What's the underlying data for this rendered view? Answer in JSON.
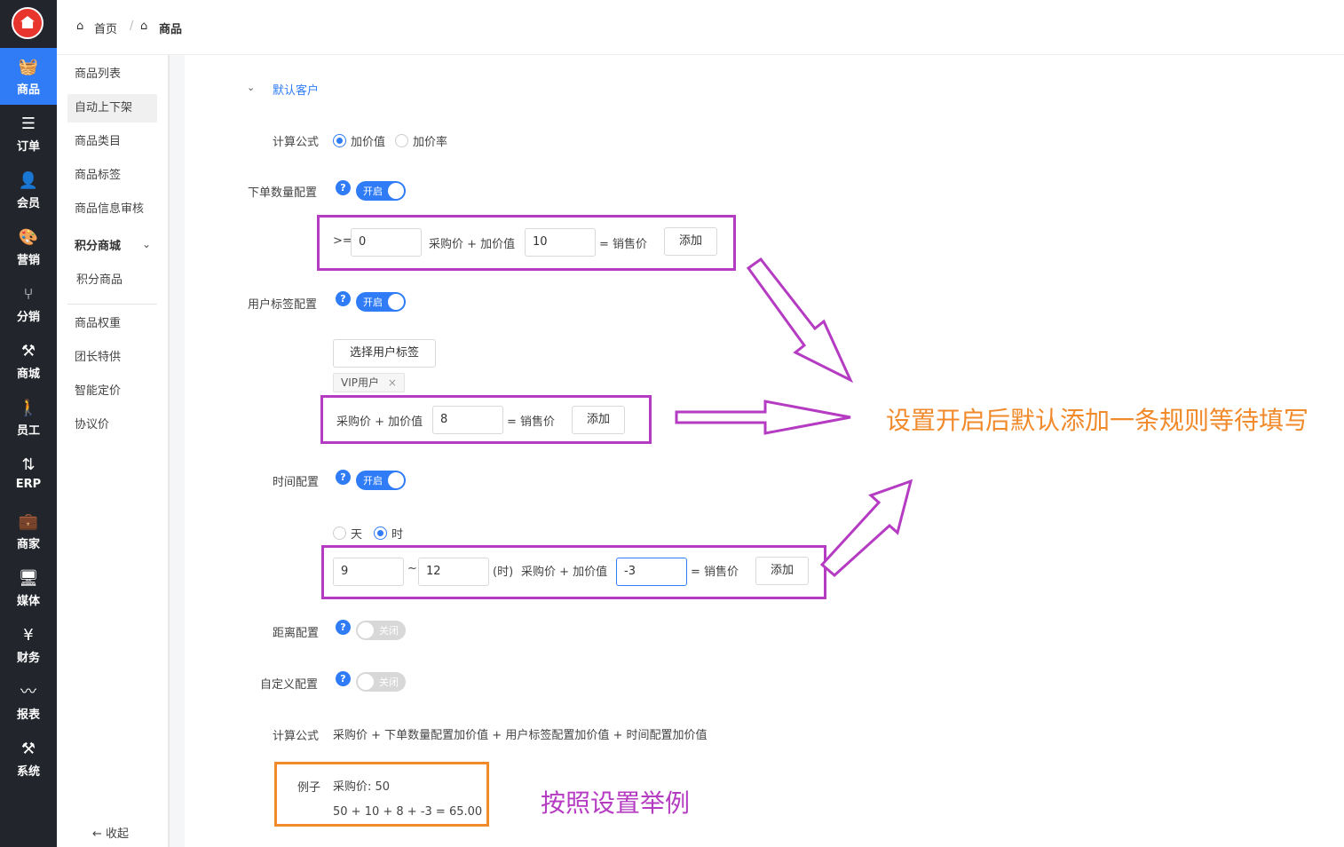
{
  "rail": {
    "items": [
      {
        "label": "商品",
        "icon": "basket-icon",
        "glyph": "🧺"
      },
      {
        "label": "订单",
        "icon": "list-icon",
        "glyph": "☰"
      },
      {
        "label": "会员",
        "icon": "user-plus-icon",
        "glyph": "👤"
      },
      {
        "label": "营销",
        "icon": "palette-icon",
        "glyph": "🎨"
      },
      {
        "label": "分销",
        "icon": "branch-icon",
        "glyph": "⑂"
      },
      {
        "label": "商城",
        "icon": "tools-icon",
        "glyph": "⚒"
      },
      {
        "label": "员工",
        "icon": "person-icon",
        "glyph": "🚶"
      },
      {
        "label": "ERP",
        "icon": "sync-icon",
        "glyph": "⇅"
      },
      {
        "label": "商家",
        "icon": "briefcase-icon",
        "glyph": "💼"
      },
      {
        "label": "媒体",
        "icon": "monitor-icon",
        "glyph": "🖥"
      },
      {
        "label": "财务",
        "icon": "yen-icon",
        "glyph": "¥"
      },
      {
        "label": "报表",
        "icon": "pulse-icon",
        "glyph": "〰"
      },
      {
        "label": "系统",
        "icon": "wrench-icon",
        "glyph": "⚒"
      }
    ]
  },
  "breadcrumb": {
    "home": "首页",
    "sep": "/",
    "current": "商品"
  },
  "submenu": {
    "items": [
      "商品列表",
      "自动上下架",
      "商品类目",
      "商品标签",
      "商品信息审核"
    ],
    "group": "积分商城",
    "group_items": [
      "积分商品"
    ],
    "items2": [
      "商品权重",
      "团长特供",
      "智能定价",
      "协议价"
    ],
    "collapse": "收起"
  },
  "form": {
    "section_title": "默认客户",
    "formula_label": "计算公式",
    "formula_options": [
      "加价值",
      "加价率"
    ],
    "qty": {
      "label": "下单数量配置",
      "switch": "开启",
      "prefix": ">=",
      "min_value": "0",
      "mid_text": "采购价 + 加价值",
      "add_value": "10",
      "suffix": "= 销售价",
      "add_button": "添加"
    },
    "tag": {
      "label": "用户标签配置",
      "switch": "开启",
      "select_button": "选择用户标签",
      "selected_tag": "VIP用户",
      "tag_close": "×",
      "mid_text": "采购价 + 加价值",
      "add_value": "8",
      "suffix": "= 销售价",
      "add_button": "添加"
    },
    "time": {
      "label": "时间配置",
      "switch": "开启",
      "unit_options": [
        "天",
        "时"
      ],
      "from_value": "9",
      "range_sep": "~",
      "to_value": "12",
      "unit_text": "(时)",
      "mid_text": "采购价 + 加价值",
      "add_value": "-3",
      "suffix": "= 销售价",
      "add_button": "添加"
    },
    "distance": {
      "label": "距离配置",
      "switch": "关闭"
    },
    "custom": {
      "label": "自定义配置",
      "switch": "关闭"
    },
    "formula_text_label": "计算公式",
    "formula_text": "采购价 + 下单数量配置加价值 + 用户标签配置加价值 + 时间配置加价值",
    "example_label": "例子",
    "example_line1": "采购价: 50",
    "example_line2": "50 + 10 + 8 + -3 = 65.00"
  },
  "annotations": {
    "default_rule": "设置开启后默认添加一条规则等待填写",
    "example_note": "按照设置举例",
    "purple": "#b43bc2",
    "orange": "#f08a2b"
  },
  "colors": {
    "accent": "#2f7cf6",
    "rail_bg": "#22252c"
  }
}
